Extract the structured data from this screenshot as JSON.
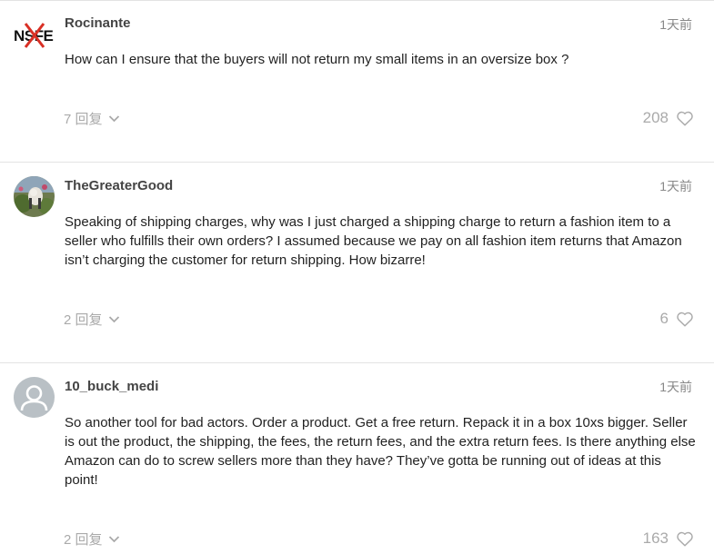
{
  "posts": [
    {
      "username": "Rocinante",
      "time": "1天前",
      "body": "How can I ensure that the buyers will not return my small items in an oversize box ?",
      "replies": "7 回复",
      "likes": "208",
      "avatar": "nsfe-logo",
      "avatar_text": "NSFE"
    },
    {
      "username": "TheGreaterGood",
      "time": "1天前",
      "body": "Speaking of shipping charges, why was I just charged a shipping charge to return a fashion item to a seller who fulfills their own orders? I assumed because we pay on all fashion item returns that Amazon isn’t charging the customer for return shipping. How bizarre!",
      "replies": "2 回复",
      "likes": "6",
      "avatar": "photo-avatar"
    },
    {
      "username": "10_buck_medi",
      "time": "1天前",
      "body": "So another tool for bad actors. Order a product. Get a free return. Repack it in a box 10xs bigger. Seller is out the product, the shipping, the fees, the return fees, and the extra return fees. Is there anything else Amazon can do to screw sellers more than they have? They’ve gotta be running out of ideas at this point!",
      "replies": "2 回复",
      "likes": "163",
      "avatar": "default-user-avatar"
    }
  ],
  "colors": {
    "nsfe_red": "#d93025",
    "muted": "#aaaaaa",
    "divider": "#e3e3e3",
    "default_avatar_bg": "#b9c0c5"
  },
  "icons": {
    "chevron": "chevron-down-icon",
    "heart": "heart-icon"
  }
}
